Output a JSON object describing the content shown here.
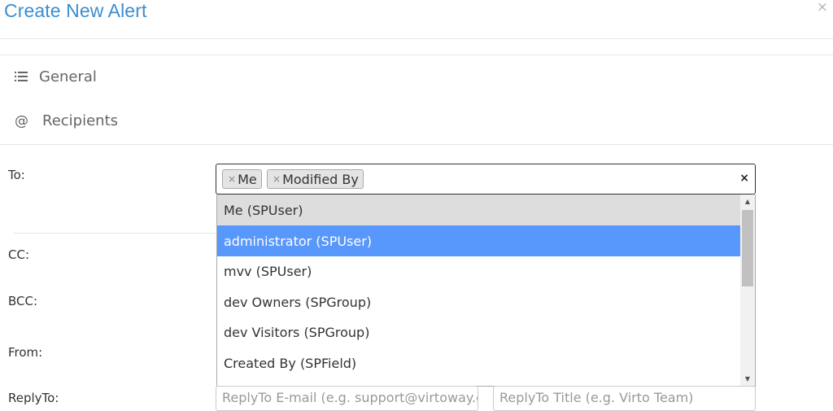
{
  "dialog": {
    "title": "Create New Alert",
    "close_icon": "×"
  },
  "nav": {
    "general_label": "General",
    "recipients_label": "Recipients",
    "recipients_icon": "@"
  },
  "fields": {
    "to_label": "To:",
    "cc_label": "CC:",
    "bcc_label": "BCC:",
    "from_label": "From:",
    "replyto_label": "ReplyTo:"
  },
  "to_field": {
    "tags": [
      {
        "remove": "×",
        "label": "Me"
      },
      {
        "remove": "×",
        "label": "Modified By"
      }
    ],
    "clear_icon": "×"
  },
  "dropdown": {
    "options": [
      {
        "label": "Me (SPUser)",
        "state": "selected"
      },
      {
        "label": "administrator (SPUser)",
        "state": "highlighted"
      },
      {
        "label": "mvv (SPUser)",
        "state": "normal"
      },
      {
        "label": "dev Owners (SPGroup)",
        "state": "normal"
      },
      {
        "label": "dev Visitors (SPGroup)",
        "state": "normal"
      },
      {
        "label": "Created By (SPField)",
        "state": "normal"
      }
    ],
    "scroll_up": "▲",
    "scroll_down": "▼"
  },
  "replyto": {
    "email_placeholder": "ReplyTo E-mail (e.g. support@virtoway.co",
    "title_placeholder": "ReplyTo Title (e.g. Virto Team)"
  },
  "colors": {
    "title": "#3b8ed0",
    "highlight": "#5897fb",
    "selected_bg": "#dddddd"
  }
}
